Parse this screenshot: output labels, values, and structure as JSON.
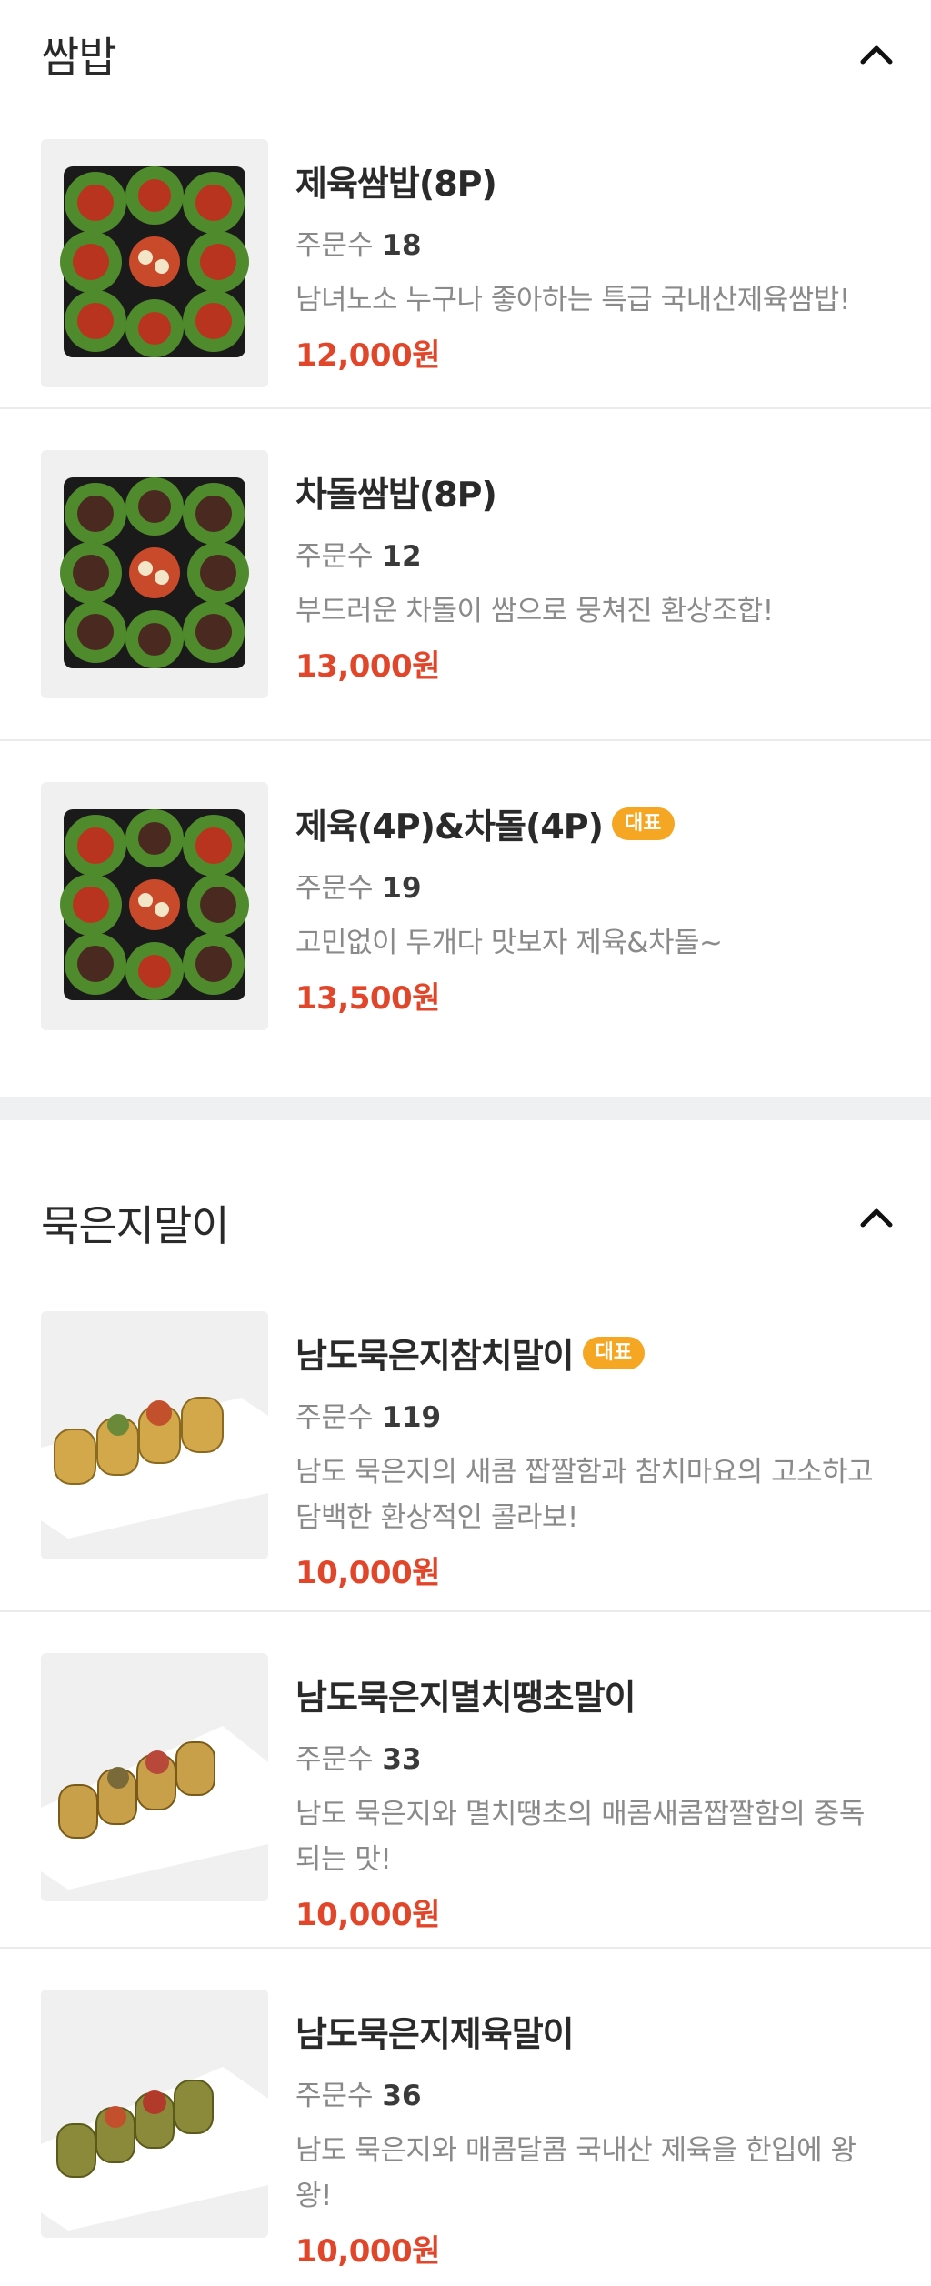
{
  "sections": [
    {
      "title": "쌈밥",
      "items": [
        {
          "name": "제육쌈밥(8P)",
          "orders_label": "주문수",
          "orders": "18",
          "desc": "남녀노소 누구나 좋아하는 특급 국내산제육쌈밥!",
          "price": "12,000원",
          "badge": ""
        },
        {
          "name": "차돌쌈밥(8P)",
          "orders_label": "주문수",
          "orders": "12",
          "desc": "부드러운 차돌이 쌈으로 뭉쳐진 환상조합!",
          "price": "13,000원",
          "badge": ""
        },
        {
          "name": "제육(4P)&차돌(4P)",
          "orders_label": "주문수",
          "orders": "19",
          "desc": "고민없이 두개다 맛보자 제육&차돌~",
          "price": "13,500원",
          "badge": "대표"
        }
      ]
    },
    {
      "title": "묵은지말이",
      "items": [
        {
          "name": "남도묵은지참치말이",
          "orders_label": "주문수",
          "orders": "119",
          "desc": "남도 묵은지의 새콤 짭짤함과 참치마요의 고소하고 담백한 환상적인 콜라보!",
          "price": "10,000원",
          "badge": "대표"
        },
        {
          "name": "남도묵은지멸치땡초말이",
          "orders_label": "주문수",
          "orders": "33",
          "desc": "남도 묵은지와 멸치땡초의 매콤새콤짭짤함의 중독되는 맛!",
          "price": "10,000원",
          "badge": ""
        },
        {
          "name": "남도묵은지제육말이",
          "orders_label": "주문수",
          "orders": "36",
          "desc": "남도 묵은지와 매콤달콤 국내산 제육을 한입에 왕왕!",
          "price": "10,000원",
          "badge": ""
        }
      ]
    }
  ],
  "colors": {
    "price": "#e2462a",
    "badge": "#f5a623",
    "divider": "#ebebeb",
    "section_gap": "#eef0f2"
  },
  "icons": {
    "collapse": "chevron-up-icon"
  }
}
